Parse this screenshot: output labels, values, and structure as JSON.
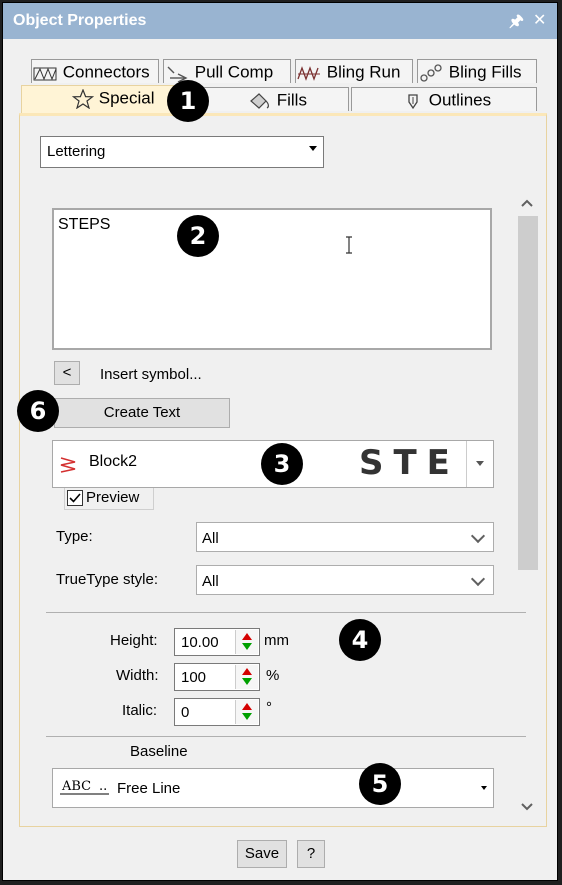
{
  "window": {
    "title": "Object Properties",
    "pin_glyph": "🖈",
    "close_glyph": "✕"
  },
  "tabs_row1": [
    {
      "label": "Connectors",
      "icon": "connectors-icon"
    },
    {
      "label": "Pull Comp",
      "icon": "pull-comp-icon"
    },
    {
      "label": "Bling Run",
      "icon": "bling-run-icon"
    },
    {
      "label": "Bling Fills",
      "icon": "bling-fills-icon"
    }
  ],
  "tabs_row2": [
    {
      "label": "Special",
      "icon": "star-icon",
      "active": true
    },
    {
      "label": "Fills",
      "icon": "fills-icon"
    },
    {
      "label": "Outlines",
      "icon": "outlines-icon"
    }
  ],
  "object_type": {
    "value": "Lettering"
  },
  "text_box": {
    "value": "STEPS"
  },
  "insert_symbol": {
    "button": "<",
    "label": "Insert symbol..."
  },
  "create_text": {
    "label": "Create Text"
  },
  "font": {
    "name": "Block2",
    "preview_text": "STE"
  },
  "preview": {
    "label": "Preview",
    "checked": true
  },
  "type": {
    "label": "Type:",
    "value": "All"
  },
  "truetype_style": {
    "label": "TrueType style:",
    "value": "All"
  },
  "height": {
    "label": "Height:",
    "value": "10.00",
    "unit": "mm"
  },
  "width": {
    "label": "Width:",
    "value": "100",
    "unit": "%"
  },
  "italic": {
    "label": "Italic:",
    "value": "0",
    "unit": "°"
  },
  "baseline": {
    "label": "Baseline",
    "sample": "ABC",
    "value": "Free Line"
  },
  "footer": {
    "save": "Save",
    "help": "?"
  },
  "markers": [
    "1",
    "2",
    "3",
    "4",
    "5",
    "6"
  ],
  "colors": {
    "titlebar": "#99b4d1",
    "active_tab": "#fff4d6",
    "frame_border": "#e8d3a0",
    "spin_up": "#d40000",
    "spin_down": "#00a000",
    "marker": "#000000"
  }
}
